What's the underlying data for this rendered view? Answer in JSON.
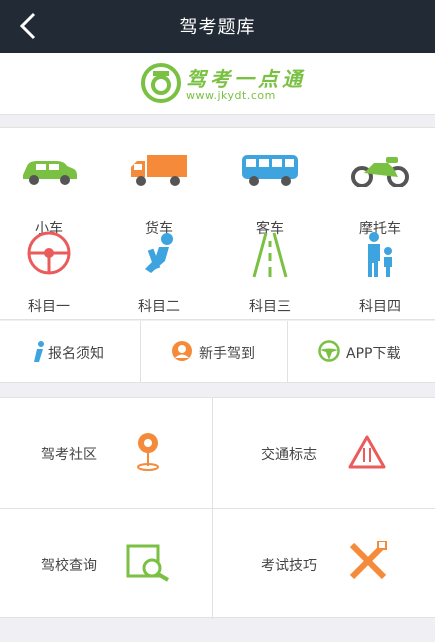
{
  "header": {
    "title": "驾考题库"
  },
  "brand": {
    "name": "驾考一点通",
    "url": "www.jkydt.com"
  },
  "categories": [
    {
      "label": "小车",
      "icon": "car-icon",
      "color": "#7ac143"
    },
    {
      "label": "货车",
      "icon": "truck-icon",
      "color": "#f58b3a"
    },
    {
      "label": "客车",
      "icon": "bus-icon",
      "color": "#3da4e0"
    },
    {
      "label": "摩托车",
      "icon": "motorcycle-icon",
      "color": "#7ac143"
    },
    {
      "label": "科目一",
      "icon": "steering-wheel-icon",
      "color": "#ea5b5b"
    },
    {
      "label": "科目二",
      "icon": "driver-seat-icon",
      "color": "#3da4e0"
    },
    {
      "label": "科目三",
      "icon": "road-icon",
      "color": "#7ac143"
    },
    {
      "label": "科目四",
      "icon": "pedestrians-icon",
      "color": "#3da4e0"
    }
  ],
  "quick_links": [
    {
      "label": "报名须知",
      "icon": "info-icon",
      "color": "#3da4e0"
    },
    {
      "label": "新手驾到",
      "icon": "user-icon",
      "color": "#f58b3a"
    },
    {
      "label": "APP下载",
      "icon": "steering-wheel-icon",
      "color": "#7ac143"
    }
  ],
  "grid": [
    {
      "label": "驾考社区",
      "icon": "location-pin-icon",
      "color": "#f58b3a"
    },
    {
      "label": "交通标志",
      "icon": "warning-sign-icon",
      "color": "#ea5b5b"
    },
    {
      "label": "驾校查询",
      "icon": "search-icon",
      "color": "#7ac143"
    },
    {
      "label": "考试技巧",
      "icon": "tools-icon",
      "color": "#f58b3a"
    }
  ]
}
